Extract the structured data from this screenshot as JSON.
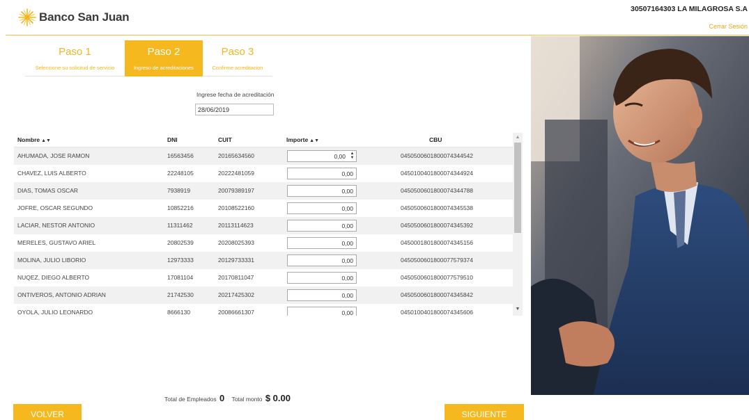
{
  "header": {
    "logo_text": "Banco San Juan",
    "company": "30507164303 LA MILAGROSA S.A",
    "logout": "Cerrar Sesión"
  },
  "steps": [
    {
      "title": "Paso 1",
      "subtitle": "Seleccione su solicitud de servicio",
      "active": false
    },
    {
      "title": "Paso 2",
      "subtitle": "Ingreso de acreditaciones",
      "active": true
    },
    {
      "title": "Paso 3",
      "subtitle": "Confirme acreditacion",
      "active": false
    }
  ],
  "date": {
    "label": "Ingrese fecha de acreditación",
    "value": "28/06/2019"
  },
  "table": {
    "headers": {
      "nombre": "Nombre",
      "dni": "DNI",
      "cuit": "CUIT",
      "importe": "Importe",
      "cbu": "CBU",
      "sort_glyph": "▲▼"
    },
    "rows": [
      {
        "nombre": "AHUMADA, JOSE RAMON",
        "dni": "16563456",
        "cuit": "20165634560",
        "importe": "0,00",
        "cbu": "0450500601800074344542"
      },
      {
        "nombre": "CHAVEZ, LUIS ALBERTO",
        "dni": "22248105",
        "cuit": "20222481059",
        "importe": "0,00",
        "cbu": "0450100401800074344924"
      },
      {
        "nombre": "DIAS, TOMAS OSCAR",
        "dni": "7938919",
        "cuit": "20079389197",
        "importe": "0,00",
        "cbu": "0450500601800074344788"
      },
      {
        "nombre": "JOFRE, OSCAR SEGUNDO",
        "dni": "10852216",
        "cuit": "20108522160",
        "importe": "0,00",
        "cbu": "0450500601800074345538"
      },
      {
        "nombre": "LACIAR, NESTOR ANTONIO",
        "dni": "11311462",
        "cuit": "20113114623",
        "importe": "0,00",
        "cbu": "0450500601800074345392"
      },
      {
        "nombre": "MERELES, GUSTAVO ARIEL",
        "dni": "20802539",
        "cuit": "20208025393",
        "importe": "0,00",
        "cbu": "0450001801800074345156"
      },
      {
        "nombre": "MOLINA, JULIO LIBORIO",
        "dni": "12973333",
        "cuit": "20129733331",
        "importe": "0,00",
        "cbu": "0450500601800077579374"
      },
      {
        "nombre": "NUQEZ, DIEGO ALBERTO",
        "dni": "17081104",
        "cuit": "20170811047",
        "importe": "0,00",
        "cbu": "0450500601800077579510"
      },
      {
        "nombre": "ONTIVEROS, ANTONIO ADRIAN",
        "dni": "21742530",
        "cuit": "20217425302",
        "importe": "0,00",
        "cbu": "0450500601800074345842"
      },
      {
        "nombre": "OYOLA, JULIO LEONARDO",
        "dni": "8666130",
        "cuit": "20086661307",
        "importe": "0,00",
        "cbu": "0450100401800074345606"
      }
    ]
  },
  "totals": {
    "employees_label": "Total de Empleados",
    "employees_value": "0",
    "amount_label": "Total monto",
    "amount_value": "$ 0.00"
  },
  "buttons": {
    "back": "VOLVER",
    "next": "SIGUIENTE"
  },
  "colors": {
    "accent": "#f5b81e",
    "logout": "#e6a817"
  }
}
